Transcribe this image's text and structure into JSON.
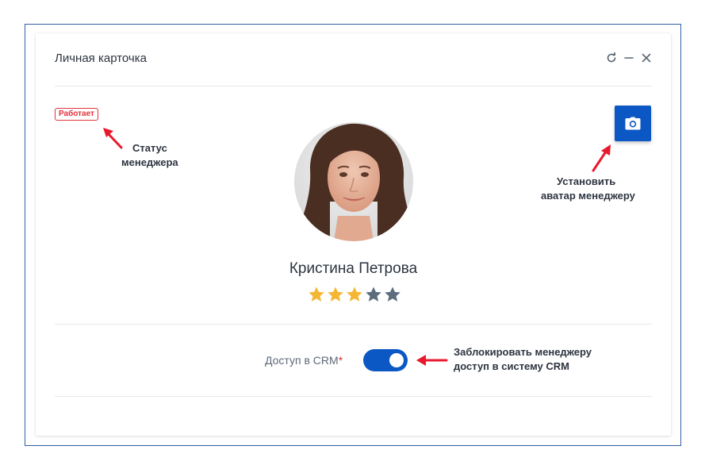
{
  "card": {
    "title": "Личная карточка"
  },
  "header_icons": [
    "refresh-icon",
    "minimize-icon",
    "close-icon"
  ],
  "status": {
    "label": "Работает",
    "color": "#e0323c"
  },
  "annotations": {
    "status_note_line1": "Статус",
    "status_note_line2": "менеджера",
    "avatar_note_line1": "Установить",
    "avatar_note_line2": "аватар менеджеру",
    "crm_note_line1": "Заблокировать менеджеру",
    "crm_note_line2": "доступ в систему CRM"
  },
  "manager": {
    "name": "Кристина Петрова",
    "rating": 3,
    "rating_max": 5
  },
  "crm_access": {
    "label": "Доступ в CRM",
    "required_mark": "*",
    "enabled": true
  },
  "colors": {
    "accent": "#0b57c4",
    "star_filled": "#f5b633",
    "star_empty": "#5c6d7e",
    "annotation_arrow": "#e8192c"
  }
}
